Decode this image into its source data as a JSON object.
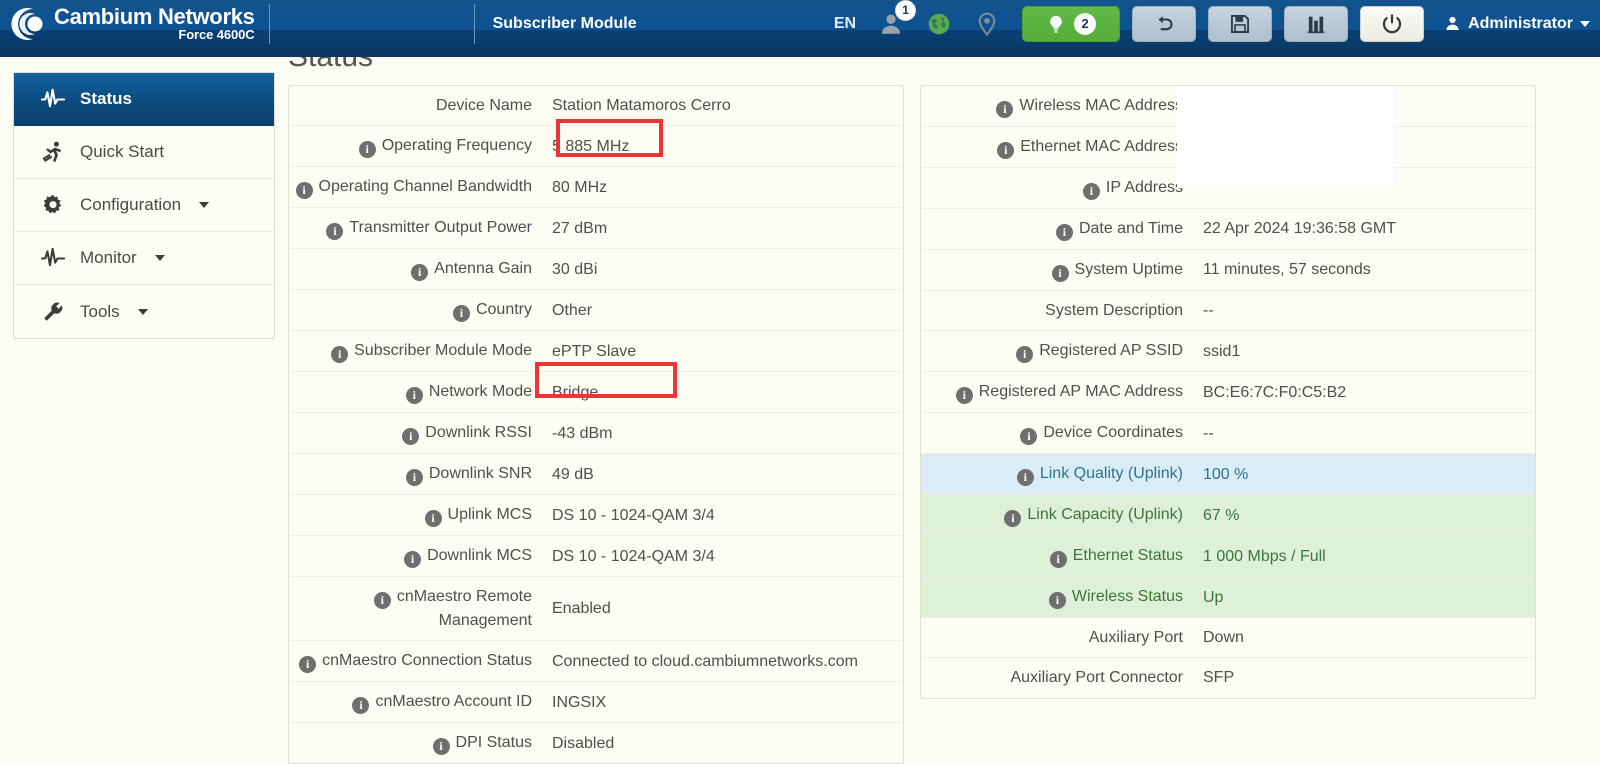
{
  "header": {
    "brand_name": "Cambium Networks",
    "brand_model": "Force 4600C",
    "page_mode": "Subscriber Module",
    "language": "EN",
    "user_icon": "user-icon",
    "user_badge": "1",
    "globe_icon": "globe-icon",
    "location_icon": "map-pin-icon",
    "alerts_icon": "lightbulb-icon",
    "alerts_badge": "2",
    "undo_icon": "undo-arrow-icon",
    "save_icon": "floppy-disk-icon",
    "export_icon": "export-icon",
    "power_icon": "power-icon",
    "admin_label": "Administrator",
    "accent_blue": "#0d5291",
    "accent_green": "#56b03a"
  },
  "sidebar": {
    "items": [
      {
        "label": "Status",
        "icon": "pulse-icon",
        "active": true,
        "has_caret": false
      },
      {
        "label": "Quick Start",
        "icon": "runner-icon",
        "active": false,
        "has_caret": false
      },
      {
        "label": "Configuration",
        "icon": "gear-icon",
        "active": false,
        "has_caret": true
      },
      {
        "label": "Monitor",
        "icon": "pulse-icon",
        "active": false,
        "has_caret": true
      },
      {
        "label": "Tools",
        "icon": "wrench-icon",
        "active": false,
        "has_caret": true
      }
    ]
  },
  "main": {
    "title": "Status",
    "left_table": [
      {
        "label": "Device Name",
        "value": "Station Matamoros Cerro",
        "info": false
      },
      {
        "label": "Operating Frequency",
        "value": "5 885 MHz",
        "info": true
      },
      {
        "label": "Operating Channel Bandwidth",
        "value": "80 MHz",
        "info": true
      },
      {
        "label": "Transmitter Output Power",
        "value": "27 dBm",
        "info": true
      },
      {
        "label": "Antenna Gain",
        "value": "30 dBi",
        "info": true
      },
      {
        "label": "Country",
        "value": "Other",
        "info": true
      },
      {
        "label": "Subscriber Module Mode",
        "value": "ePTP Slave",
        "info": true
      },
      {
        "label": "Network Mode",
        "value": "Bridge",
        "info": true
      },
      {
        "label": "Downlink RSSI",
        "value": "-43 dBm",
        "info": true
      },
      {
        "label": "Downlink SNR",
        "value": "49 dB",
        "info": true
      },
      {
        "label": "Uplink MCS",
        "value": "DS 10 - 1024-QAM 3/4",
        "info": true
      },
      {
        "label": "Downlink MCS",
        "value": "DS 10 - 1024-QAM 3/4",
        "info": true
      },
      {
        "label": "cnMaestro Remote Management",
        "value": "Enabled",
        "info": true
      },
      {
        "label": "cnMaestro Connection Status",
        "value": "Connected to cloud.cambiumnetworks.com",
        "info": true
      },
      {
        "label": "cnMaestro Account ID",
        "value": "INGSIX",
        "info": true
      },
      {
        "label": "DPI Status",
        "value": "Disabled",
        "info": true
      }
    ],
    "right_table": [
      {
        "label": "Wireless MAC Address",
        "value": "",
        "info": true,
        "highlight": "none"
      },
      {
        "label": "Ethernet MAC Address",
        "value": "",
        "info": true,
        "highlight": "none"
      },
      {
        "label": "IP Address",
        "value": "",
        "info": true,
        "highlight": "none"
      },
      {
        "label": "Date and Time",
        "value": "22 Apr 2024 19:36:58 GMT",
        "info": true,
        "highlight": "none"
      },
      {
        "label": "System Uptime",
        "value": "11 minutes, 57 seconds",
        "info": true,
        "highlight": "none"
      },
      {
        "label": "System Description",
        "value": "--",
        "info": false,
        "highlight": "none"
      },
      {
        "label": "Registered AP SSID",
        "value": "ssid1",
        "info": true,
        "highlight": "none"
      },
      {
        "label": "Registered AP MAC Address",
        "value": "BC:E6:7C:F0:C5:B2",
        "info": true,
        "highlight": "none"
      },
      {
        "label": "Device Coordinates",
        "value": "--",
        "info": true,
        "highlight": "none"
      },
      {
        "label": "Link Quality (Uplink)",
        "value": "100 %",
        "info": true,
        "highlight": "blue"
      },
      {
        "label": "Link Capacity (Uplink)",
        "value": "67 %",
        "info": true,
        "highlight": "green"
      },
      {
        "label": "Ethernet Status",
        "value": "1 000 Mbps / Full",
        "info": true,
        "highlight": "green"
      },
      {
        "label": "Wireless Status",
        "value": "Up",
        "info": true,
        "highlight": "green"
      },
      {
        "label": "Auxiliary Port",
        "value": "Down",
        "info": false,
        "highlight": "none"
      },
      {
        "label": "Auxiliary Port Connector",
        "value": "SFP",
        "info": false,
        "highlight": "none"
      }
    ]
  },
  "annotations": {
    "box_color": "#ee3437",
    "boxes": [
      {
        "name": "operating-frequency-highlight",
        "target": "Operating Frequency"
      },
      {
        "name": "downlink-rssi-highlight",
        "target": "Downlink RSSI"
      }
    ]
  }
}
